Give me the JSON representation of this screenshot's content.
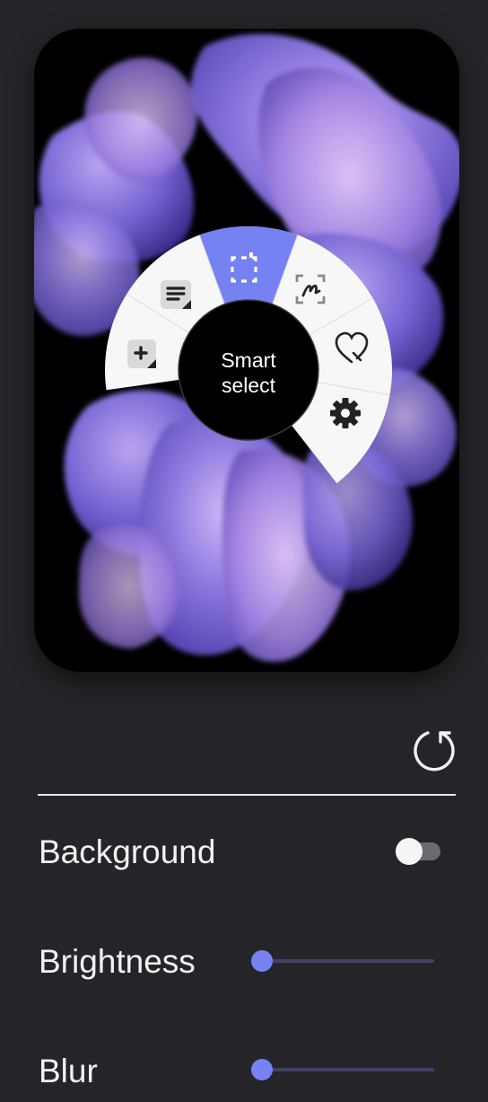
{
  "preview": {
    "center_label": "Smart\nselect",
    "center_line1": "Smart",
    "center_line2": "select",
    "menu_items": [
      {
        "name": "create-note",
        "icon": "note-plus-icon"
      },
      {
        "name": "view-all-notes",
        "icon": "notes-list-icon"
      },
      {
        "name": "smart-select",
        "icon": "crop-select-icon",
        "selected": true
      },
      {
        "name": "screen-write",
        "icon": "screen-write-icon"
      },
      {
        "name": "favorites",
        "icon": "heart-icon"
      },
      {
        "name": "settings",
        "icon": "gear-icon"
      }
    ]
  },
  "controls": {
    "reset_icon": "reset-icon",
    "background": {
      "label": "Background",
      "enabled": false
    },
    "brightness": {
      "label": "Brightness",
      "value": 0
    },
    "blur": {
      "label": "Blur",
      "value": 0
    }
  },
  "colors": {
    "page_bg": "#252529",
    "accent": "#7681F2",
    "menu_bg": "#F7F7F7",
    "slider_track": "#3F4366"
  }
}
